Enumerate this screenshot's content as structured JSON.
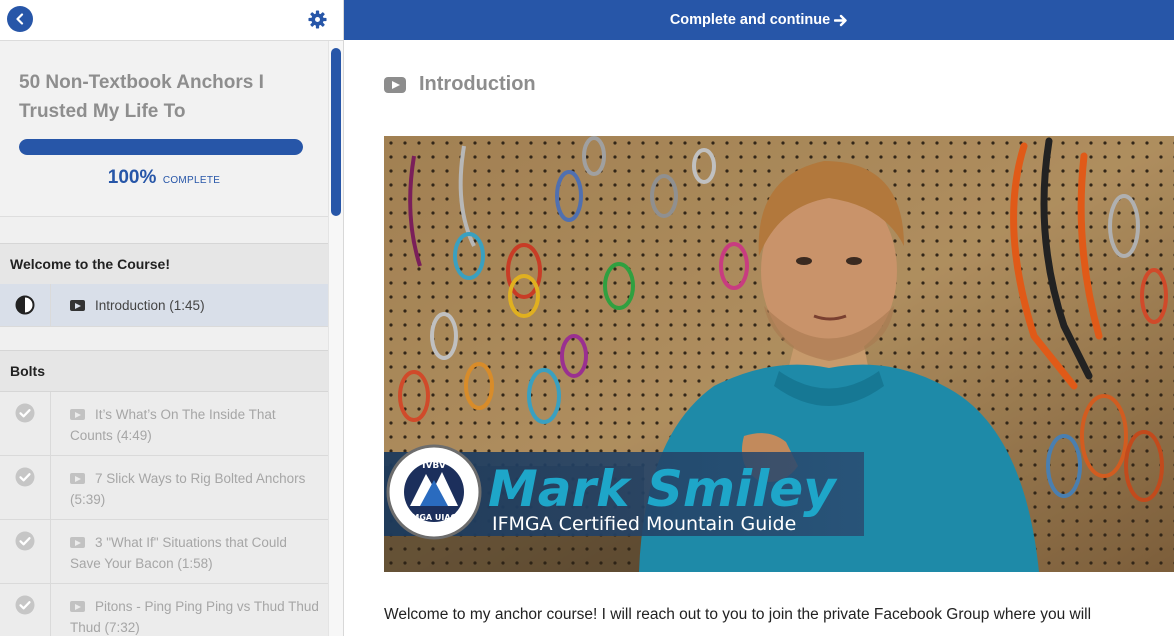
{
  "sidebar": {
    "course_title": "50 Non-Textbook Anchors I Trusted My Life To",
    "progress_value": 100,
    "progress_percent": "100%",
    "progress_word": "complete",
    "sections": [
      {
        "title": "Welcome to the Course!",
        "lectures": [
          {
            "title": "Introduction (1:45)",
            "status": "in-progress"
          }
        ]
      },
      {
        "title": "Bolts",
        "lectures": [
          {
            "title": "It’s What’s On The Inside That Counts (4:49)",
            "status": "completed"
          },
          {
            "title": "7 Slick Ways to Rig Bolted Anchors (5:39)",
            "status": "completed"
          },
          {
            "title": "3 \"What If\" Situations that Could Save Your Bacon (1:58)",
            "status": "completed"
          },
          {
            "title": "Pitons - Ping Ping Ping vs Thud Thud Thud (7:32)",
            "status": "completed"
          }
        ]
      }
    ]
  },
  "main": {
    "complete_button_label": "Complete and continue",
    "lecture_title": "Introduction",
    "video": {
      "name_overlay": "Mark Smiley",
      "subtitle_overlay": "IFMGA Certified Mountain Guide",
      "badge_text": "IVBV · BERGFÜHRER · MOUNTAIN GUIDE · UIAGM · IFMGA · GUIDA · GUIDE DE MONTAGNE"
    },
    "intro_text": "Welcome to my anchor course! I will reach out to you to join the private Facebook Group where you will"
  },
  "colors": {
    "accent": "#2756a8",
    "overlay_text": "#1ea6c9"
  }
}
